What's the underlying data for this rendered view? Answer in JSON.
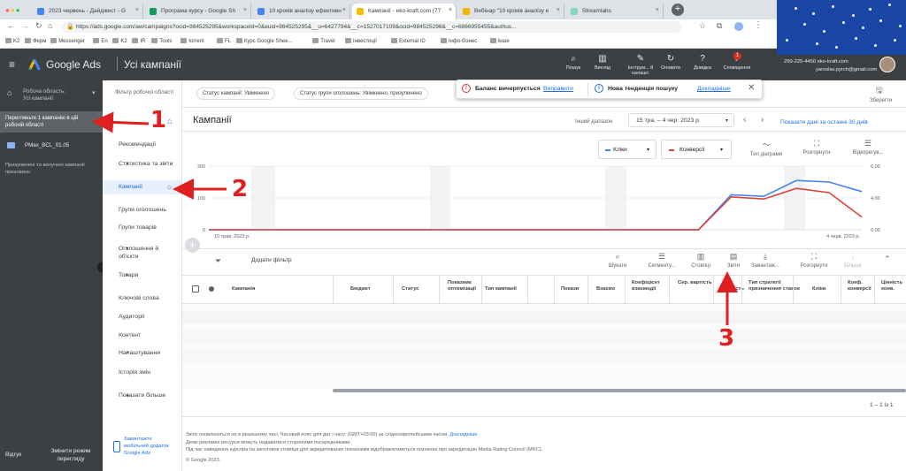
{
  "browser": {
    "tabs": [
      {
        "label": "2023 червень - Дайджест - G",
        "color": "#4285f4"
      },
      {
        "label": "Програма курсу - Google Sh",
        "color": "#0f9d58"
      },
      {
        "label": "10 кроків аналізу ефективн",
        "color": "#4285f4"
      },
      {
        "label": "Кампанії - eko-kraft.com (77",
        "color": "#fbbc04"
      },
      {
        "label": "Вебінар \"10 кроків аналізу е",
        "color": "#f4b400"
      },
      {
        "label": "Streamlabs",
        "color": "#80d8c0"
      }
    ],
    "url": "https://ads.google.com/aw/campaigns?ocid=984525295&workspaceId=0&euid=984525295&__u=6427794&__c=1527017109&ocid=984525296&__c=6866955455&authus...",
    "bookmarks": [
      "K2",
      "Ферм",
      "Messenger",
      "En",
      "K2",
      "IR",
      "Tools",
      "torrent",
      "FL",
      "Курс Google Shee...",
      "Travel",
      "Інвестиції",
      "External ID",
      "Інфо-бізнес",
      "Інше"
    ]
  },
  "header": {
    "menu_icon": "hamburger-icon",
    "product": "Google Ads",
    "section": "Усі кампанії",
    "buttons": [
      {
        "label": "Пошук",
        "icon": "search-icon"
      },
      {
        "label": "Вигляд",
        "icon": "chart-icon"
      },
      {
        "label": "Інструм... й налашт.",
        "icon": "wrench-icon"
      },
      {
        "label": "Оновити",
        "icon": "refresh-icon"
      },
      {
        "label": "Довідка",
        "icon": "help-icon"
      },
      {
        "label": "Сповіщення",
        "icon": "bell-icon"
      }
    ],
    "notification_count": "1",
    "account_id": "299-225-4450 eko-kraft.com",
    "account_email": "yaroslav.pyrch@gmail.com"
  },
  "left_sidebar": {
    "workspace_line1": "Робоча область:",
    "workspace_line2": "Усі кампанії",
    "highlight": "Перегляньте 1 кампанію в цій робочій області",
    "campaign": "PMax_BCL_01.05",
    "note": "Призупинені та вилучені кампанії приховано",
    "feedback": "Відгук",
    "switch_mode": "Змінити режим перегляду"
  },
  "filter_bar": {
    "label": "Фільтр робочої області",
    "chip1": "Статус кампанії: Увімкнено",
    "chip2": "Статус групи оголошень: Увімкнено, призупинено",
    "save": "Зберегти"
  },
  "alerts": {
    "budget": "Баланс вичерпується",
    "budget_link": "Виправити",
    "trend": "Нова тенденція пошуку",
    "trend_link": "Докладніше"
  },
  "nav": {
    "items": [
      "Рекомендації",
      "Статистика та звіти",
      "Кампанії",
      "Групи оголошень",
      "Групи товарів",
      "Оголошення й об'єкти",
      "Товари",
      "Ключові слова",
      "Аудиторії",
      "Контент",
      "Налаштування",
      "Історія змін",
      "Показати більше"
    ]
  },
  "page": {
    "title": "Кампанії",
    "other_range": "Інший діапазон",
    "date_range": "15 тра. – 4 чер. 2023 р.",
    "show_last": "Показати дані за останні 30 днів",
    "metric1": "Кліки",
    "metric2": "Конверсії",
    "chart_tools": [
      "Тип діаграми",
      "Розгорнути",
      "Відкорегув..."
    ],
    "add_filter": "Додати фільтр",
    "table_tools": [
      "Шукати",
      "Сегменту...",
      "Стовпці",
      "Звіти",
      "Завантаж...",
      "Розгорнути",
      "Більше"
    ],
    "columns": [
      "Кампанія",
      "Бюджет",
      "Статус",
      "Показник оптимізації",
      "Тип кампанії",
      "Покази",
      "Взаємо",
      "Коефіцієнт взаємодії",
      "Сер. вартість",
      "Вартість",
      "Тип стратегії призначення ставок",
      "Кліки",
      "Коеф. конверсії",
      "Цінність конв."
    ],
    "pagination": "1 – 1 із 1",
    "footer1": "Звіти оновлюються не в реальному часі. Часовий пояс для дат і часу: (GMT+03:00) за східноєвропейським часом.",
    "footer1_link": "Докладніше",
    "footer2": "Деякі рекламні ресурси можуть надаватися сторонніми посередниками.",
    "footer3": "Під час наведення курсора на заголовок стовпця для акредитованих показників відображатиметься позначка про акредитацію Media Rating Council (MRC).",
    "copyright": "© Google 2023.",
    "mobile_app": "Завантажте мобільний додаток Google Ads"
  },
  "chart_data": {
    "type": "line",
    "x_start_label": "15 трав. 2023 р.",
    "x_end_label": "4 черв. 2023 р.",
    "x": [
      1,
      2,
      3,
      4,
      5,
      6,
      7,
      8,
      9,
      10,
      11,
      12,
      13,
      14,
      15,
      16,
      17,
      18,
      19,
      20,
      21
    ],
    "left_ticks": [
      "300",
      "100",
      "0"
    ],
    "right_ticks": [
      "6,00",
      "4,00",
      "0,00"
    ],
    "series": [
      {
        "name": "Кліки",
        "axis": "left",
        "color": "#4285f4",
        "values": [
          0,
          0,
          0,
          0,
          0,
          0,
          0,
          0,
          0,
          0,
          0,
          0,
          0,
          0,
          0,
          0,
          110,
          105,
          155,
          150,
          120
        ]
      },
      {
        "name": "Конверсії",
        "axis": "right",
        "color": "#db4437",
        "values": [
          0,
          0,
          0,
          0,
          0,
          0,
          0,
          0,
          0,
          0,
          0,
          0,
          0,
          0,
          0,
          0,
          3.1,
          2.9,
          3.9,
          3.5,
          1.2
        ]
      }
    ],
    "ylim_left": [
      0,
      200
    ],
    "ylim_right": [
      0,
      6
    ]
  },
  "annotations": [
    "1",
    "2",
    "3"
  ],
  "colors": {
    "accent": "#1a73e8",
    "annotation": "#e02020",
    "dark": "#3c4043"
  }
}
